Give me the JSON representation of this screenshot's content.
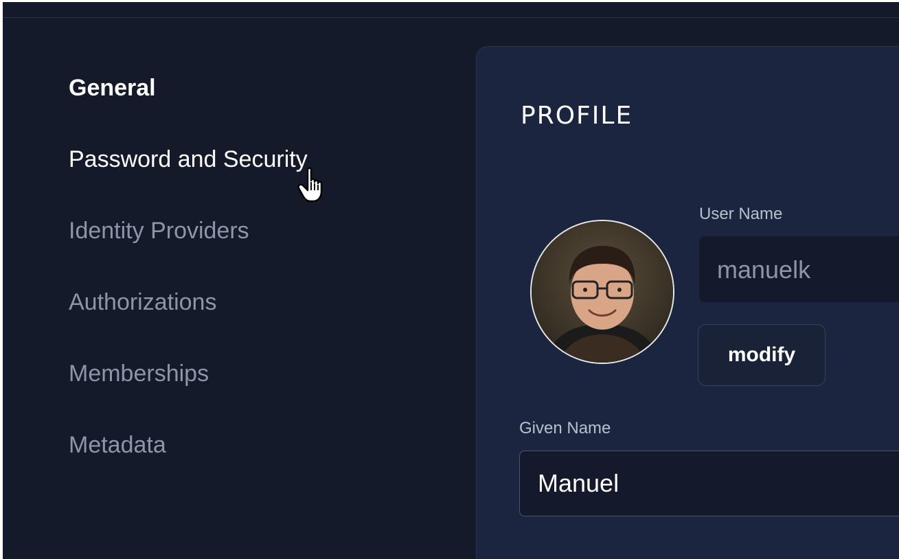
{
  "sidebar": {
    "items": [
      {
        "label": "General",
        "state": "active"
      },
      {
        "label": "Password and Security",
        "state": "hover"
      },
      {
        "label": "Identity Providers",
        "state": "default"
      },
      {
        "label": "Authorizations",
        "state": "default"
      },
      {
        "label": "Memberships",
        "state": "default"
      },
      {
        "label": "Metadata",
        "state": "default"
      }
    ]
  },
  "profile": {
    "title": "PROFILE",
    "username_label": "User Name",
    "username_value": "manuelk",
    "modify_label": "modify",
    "given_name_label": "Given Name",
    "given_name_value": "Manuel"
  },
  "icons": {
    "cursor": "hand-pointer-icon"
  },
  "colors": {
    "background": "#141a29",
    "card": "#1c2540",
    "text_active": "#ffffff",
    "text_muted": "#8d96a6"
  }
}
